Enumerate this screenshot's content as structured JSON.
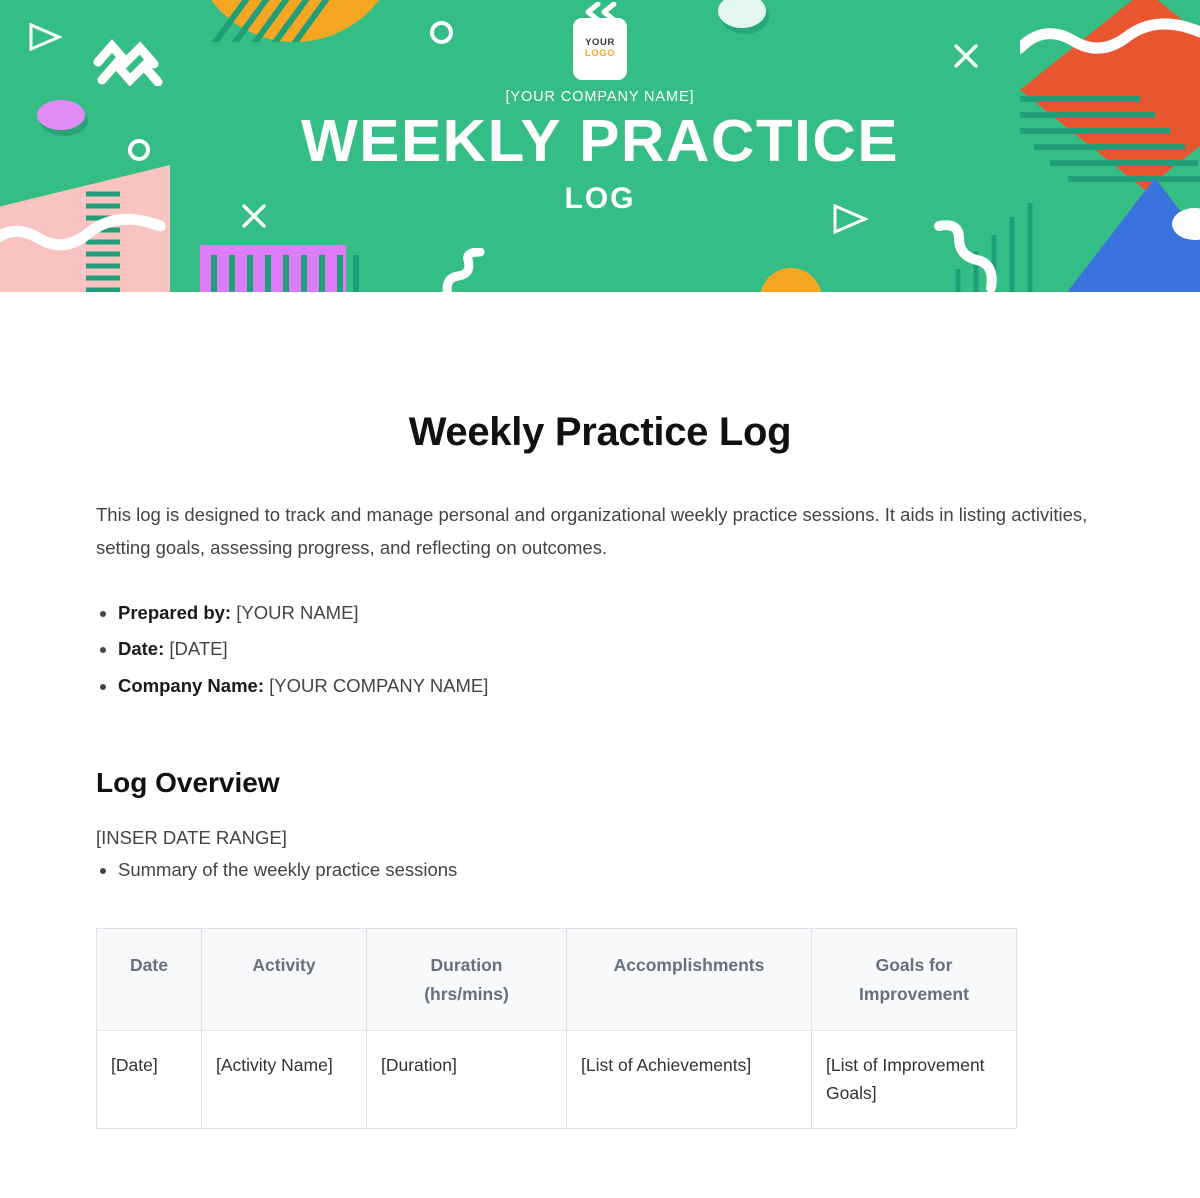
{
  "banner": {
    "logo": {
      "line1": "YOUR",
      "line2": "LOGO"
    },
    "company_name": "[YOUR COMPANY NAME]",
    "title": "WEEKLY PRACTICE",
    "subtitle": "LOG",
    "colors": {
      "background_green": "#35bd86",
      "orange": "#f5a623",
      "red": "#e8552f",
      "blue": "#3a73de",
      "pink": "#f8c3c1",
      "magenta": "#dd7df8",
      "lilac": "#e08cf7",
      "mint": "#e3f7f0",
      "white": "#ffffff",
      "teal_stripe": "#1f9e77"
    }
  },
  "document": {
    "title": "Weekly Practice Log",
    "intro": "This log is designed to track and manage personal and organizational weekly practice sessions. It aids in listing activities, setting goals, assessing progress, and reflecting on outcomes.",
    "meta": [
      {
        "label": "Prepared by:",
        "value": "[YOUR NAME]"
      },
      {
        "label": "Date:",
        "value": "[DATE]"
      },
      {
        "label": "Company Name:",
        "value": "[YOUR COMPANY NAME]"
      }
    ],
    "section": {
      "heading": "Log Overview",
      "date_range": "[INSER DATE RANGE]",
      "summary_items": [
        "Summary of the weekly practice sessions"
      ]
    },
    "table": {
      "headers": [
        "Date",
        "Activity",
        "Duration (hrs/mins)",
        "Accomplishments",
        "Goals for Improvement"
      ],
      "header_lines": {
        "duration_line1": "Duration",
        "duration_line2": "(hrs/mins)",
        "goals_line1": "Goals for",
        "goals_line2": "Improvement"
      },
      "rows": [
        {
          "date": "[Date]",
          "activity": "[Activity Name]",
          "duration": "[Duration]",
          "accomplishments": "[List of Achievements]",
          "goals": "[List of Improvement Goals]"
        }
      ]
    }
  }
}
